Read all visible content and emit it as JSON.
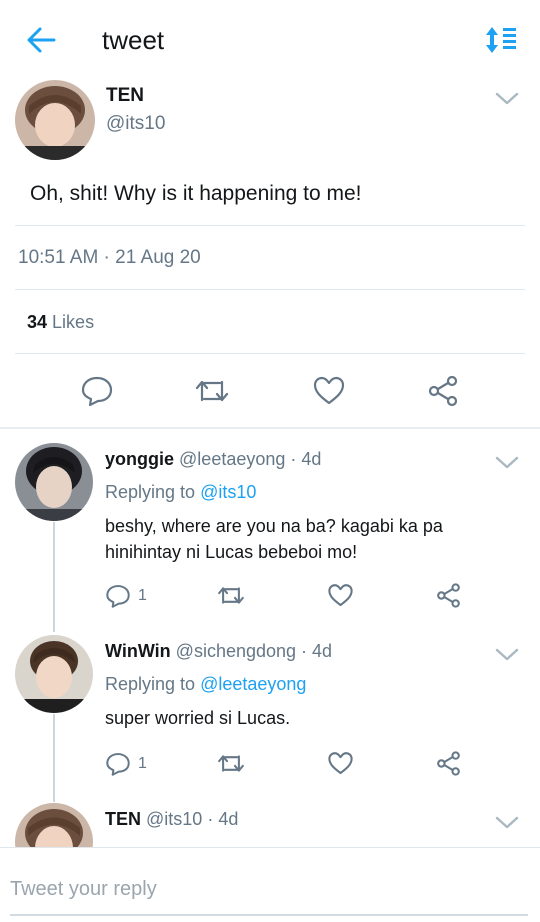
{
  "header": {
    "title": "tweet"
  },
  "main_tweet": {
    "name": "TEN",
    "handle": "@its10",
    "text": "Oh, shit! Why is it happening to me!",
    "timestamp": "10:51 AM · 21 Aug 20",
    "likes_count": "34",
    "likes_label": "Likes"
  },
  "replies": [
    {
      "name": "yonggie",
      "handle": "@leetaeyong",
      "time": "· 4d",
      "replying_label": "Replying to",
      "replying_to": "@its10",
      "text_line1": "beshy, where are you na ba? kagabi ka pa",
      "text_line2": "hinihintay ni Lucas bebeboi mo!",
      "reply_count": "1"
    },
    {
      "name": "WinWin",
      "handle": "@sichengdong",
      "time": "· 4d",
      "replying_label": "Replying to",
      "replying_to": "@leetaeyong",
      "text_line1": "super worried si Lucas.",
      "reply_count": "1"
    },
    {
      "name": "TEN",
      "handle": "@its10",
      "time": "· 4d"
    }
  ],
  "compose": {
    "placeholder": "Tweet your reply"
  },
  "colors": {
    "accent": "#1da1f2",
    "secondary_text": "#657786",
    "divider": "#e1e8ed"
  }
}
